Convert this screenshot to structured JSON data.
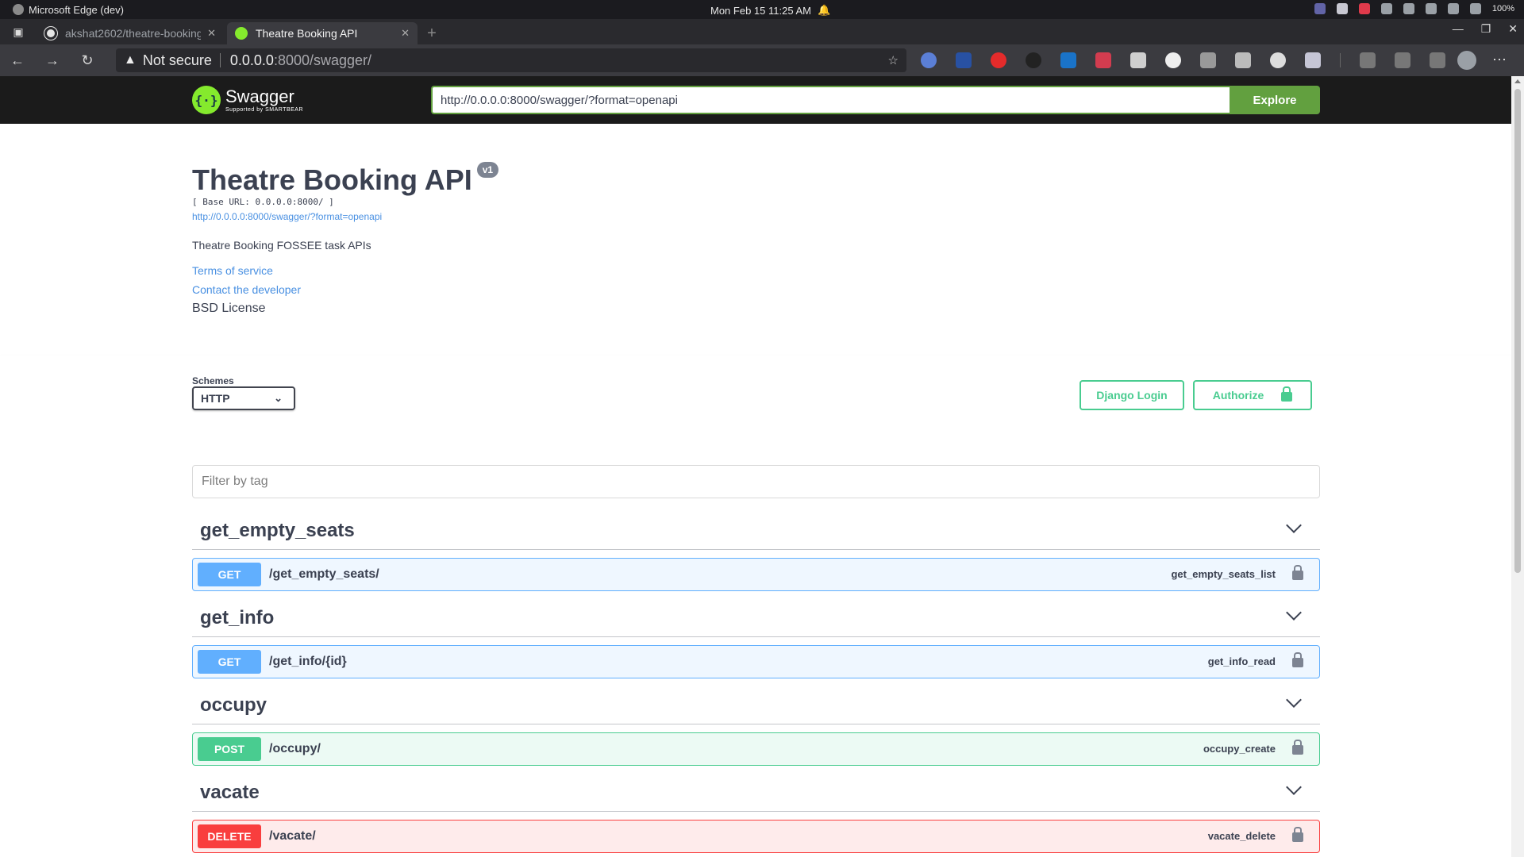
{
  "os": {
    "app_name": "Microsoft Edge (dev)",
    "clock": "Mon Feb 15  11:25 AM",
    "battery": "100%"
  },
  "tabs": [
    {
      "title": "akshat2602/theatre-booking",
      "active": false
    },
    {
      "title": "Theatre Booking API",
      "active": true
    }
  ],
  "address": {
    "security": "Not secure",
    "host": "0.0.0.0",
    "path": ":8000/swagger/"
  },
  "swagger_bar": {
    "logo_word": "Swagger",
    "logo_sub": "Supported by SMARTBEAR",
    "url_value": "http://0.0.0.0:8000/swagger/?format=openapi",
    "explore_label": "Explore"
  },
  "info": {
    "title": "Theatre Booking API",
    "version": "v1",
    "base_url": "[ Base URL: 0.0.0.0:8000/ ]",
    "spec_url": "http://0.0.0.0:8000/swagger/?format=openapi",
    "description": "Theatre Booking FOSSEE task APIs",
    "terms": "Terms of service",
    "contact": "Contact the developer",
    "license": "BSD License"
  },
  "schemes": {
    "label": "Schemes",
    "selected": "HTTP",
    "django_login": "Django Login",
    "authorize": "Authorize"
  },
  "filter": {
    "placeholder": "Filter by tag"
  },
  "tags": [
    {
      "name": "get_empty_seats",
      "method": "GET",
      "path": "/get_empty_seats/",
      "op_id": "get_empty_seats_list"
    },
    {
      "name": "get_info",
      "method": "GET",
      "path": "/get_info/{id}",
      "op_id": "get_info_read"
    },
    {
      "name": "occupy",
      "method": "POST",
      "path": "/occupy/",
      "op_id": "occupy_create"
    },
    {
      "name": "vacate",
      "method": "DELETE",
      "path": "/vacate/",
      "op_id": "vacate_delete"
    }
  ],
  "colors": {
    "get": "#61affe",
    "post": "#49cc90",
    "delete": "#f93e3e",
    "swagger_green": "#62a03f",
    "link": "#4990e2"
  },
  "icons": {
    "os_app": "edge-icon",
    "notification": "bell-icon",
    "sidebar": "tab-actions-icon",
    "back": "back-arrow-icon",
    "forward": "forward-arrow-icon",
    "refresh": "refresh-icon",
    "warning": "warning-icon",
    "add_favorite": "star-plus-icon",
    "lock": "lock-icon",
    "chevron": "chevron-down-icon"
  }
}
